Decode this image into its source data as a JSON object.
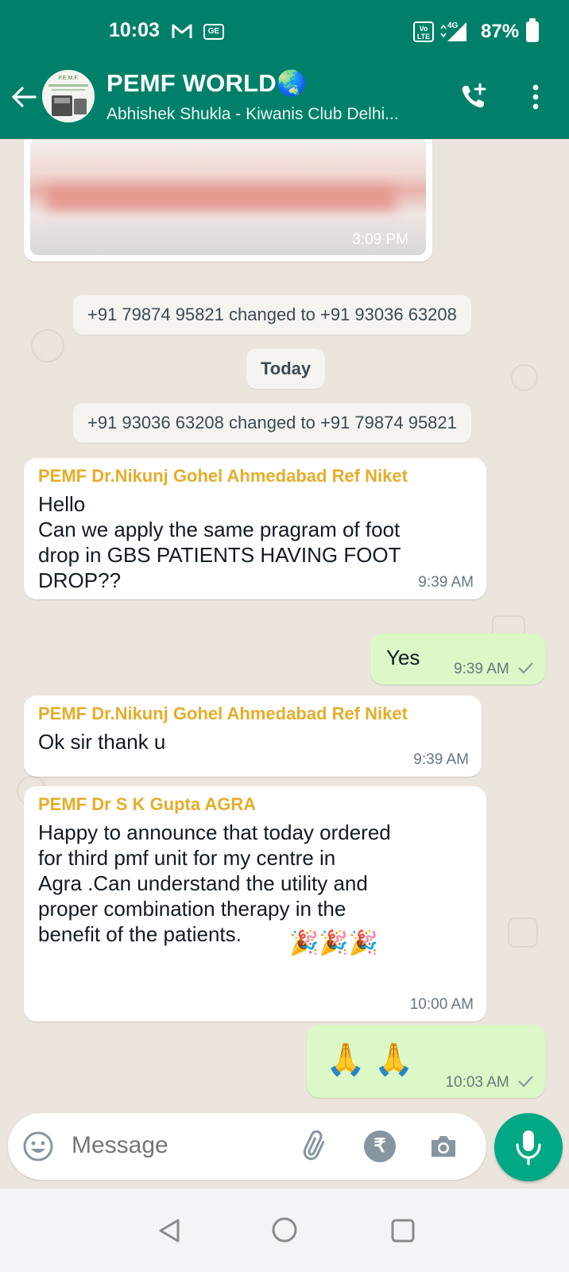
{
  "status_bar": {
    "time": "10:03",
    "icons": [
      "gmail-icon",
      "ge-icon",
      "volte-icon",
      "4g-signal-icon",
      "battery-icon"
    ],
    "ge_label": "GE",
    "volte_label": "Vo LTE",
    "network_label": "4G",
    "battery": "87%"
  },
  "header": {
    "title": "PEMF WORLD🌏",
    "subtitle": "Abhishek Shukla - Kiwanis Club Delhi...",
    "colors": {
      "bar": "#008069"
    }
  },
  "messages": {
    "image_msg": {
      "time": "3:09 PM"
    },
    "sys1": "+91 79874 95821 changed to +91 93036 63208",
    "day": "Today",
    "sys2": "+91 93036 63208 changed to +91 79874 95821",
    "m1": {
      "sender": "PEMF Dr.Nikunj  Gohel Ahmedabad Ref Niket",
      "text": "Hello\nCan we apply the same pragram of foot\ndrop in GBS PATIENTS HAVING FOOT\nDROP??",
      "time": "9:39 AM"
    },
    "m2": {
      "text": "Yes",
      "time": "9:39 AM"
    },
    "m3": {
      "sender": "PEMF Dr.Nikunj  Gohel Ahmedabad Ref Niket",
      "text": "Ok sir thank u",
      "time": "9:39 AM"
    },
    "m4": {
      "sender": "PEMF Dr S K Gupta AGRA",
      "text": "Happy to announce that today ordered\nfor third pmf unit for my centre in\nAgra .Can understand the utility and\nproper combination therapy in the\nbenefit of the patients.",
      "emoji": "🎉🎉🎉",
      "time": "10:00 AM"
    },
    "m5": {
      "emoji": "🙏 🙏",
      "time": "10:03 AM"
    }
  },
  "input": {
    "placeholder": "Message",
    "rupee": "₹"
  },
  "colors": {
    "chat_bg": "#ECE5DD",
    "outgoing": "#DCF8C6",
    "sender_name": "#e5ad2a",
    "accent": "#00a884"
  }
}
